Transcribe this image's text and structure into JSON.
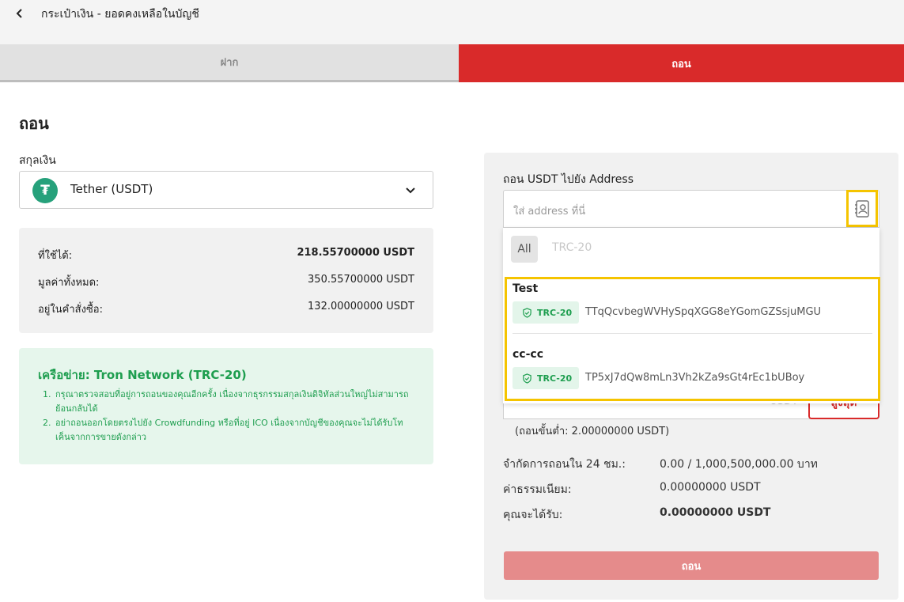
{
  "header": {
    "title": "กระเป๋าเงิน - ยอดคงเหลือในบัญชี"
  },
  "tabs": [
    {
      "label": "ฝาก",
      "active": false
    },
    {
      "label": "ถอน",
      "active": true
    }
  ],
  "page_title": "ถอน",
  "currency": {
    "label": "สกุลเงิน",
    "selected": "Tether (USDT)",
    "icon": "tether-icon",
    "icon_glyph": "₮"
  },
  "balance": {
    "rows": [
      {
        "label": "ที่ใช้ได้:",
        "value": "218.55700000 USDT"
      },
      {
        "label": "มูลค่าทั้งหมด:",
        "value": "350.55700000 USDT"
      },
      {
        "label": "อยู่ในคำสั่งซื้อ:",
        "value": "132.00000000 USDT"
      }
    ]
  },
  "network": {
    "title": "เครือข่าย: Tron Network (TRC-20)",
    "notes": [
      {
        "num": "1.",
        "text": "กรุณาตรวจสอบที่อยู่การถอนของคุณอีกครั้ง เนื่องจากธุรกรรมสกุลเงินดิจิทัลส่วนใหญ่ไม่สามารถย้อนกลับได้"
      },
      {
        "num": "2.",
        "text": "อย่าถอนออกโดยตรงไปยัง Crowdfunding หรือที่อยู่ ICO เนื่องจากบัญชีของคุณจะไม่ได้รับโทเค็นจากการขายดังกล่าว"
      }
    ]
  },
  "withdraw_form": {
    "address_label": "ถอน USDT ไปยัง Address",
    "address_placeholder": "ใส่ address ที่นี่",
    "filters": {
      "all": "All",
      "trc": "TRC-20"
    },
    "saved_addresses": [
      {
        "name": "Test",
        "network": "TRC-20",
        "address": "TTqQcvbegWVHySpqXGG8eYGomGZSsjuMGU"
      },
      {
        "name": "cc-cc",
        "network": "TRC-20",
        "address": "TP5xJ7dQw8mLn3Vh2kZa9sGt4rEc1bUBoy"
      }
    ],
    "amount_unit": "USDT",
    "max_label": "สูงสุด",
    "min_note": "(ถอนขั้นต่ำ: 2.00000000 USDT)",
    "limit_label": "จำกัดการถอนใน 24 ชม.:",
    "limit_value": "0.00 / 1,000,500,000.00 บาท",
    "fee_label": "ค่าธรรมเนียม:",
    "fee_value": "0.00000000 USDT",
    "receive_label": "คุณจะได้รับ:",
    "receive_value": "0.00000000 USDT",
    "submit_label": "ถอน"
  },
  "colors": {
    "accent": "#d92a2a",
    "success": "#1e9e4f",
    "highlight": "#f5c400"
  }
}
